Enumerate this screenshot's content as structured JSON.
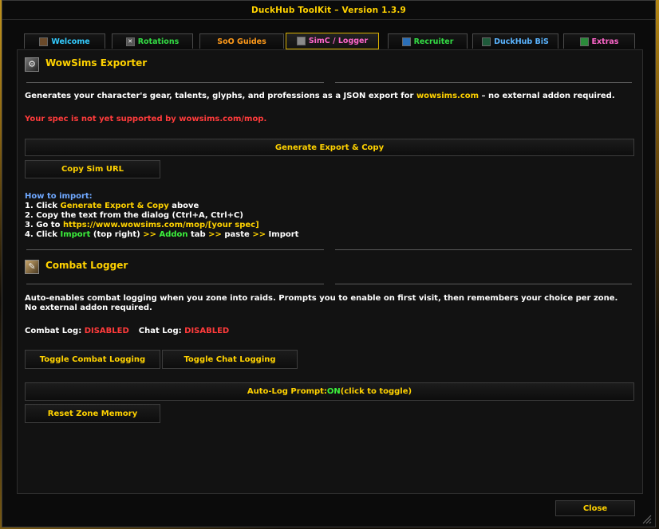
{
  "window": {
    "title": "DuckHub ToolKit  –  Version 1.3.9",
    "close_label": "Close"
  },
  "tabs": [
    {
      "label": "Welcome",
      "icon": "welcome-icon",
      "color": "#33ccff"
    },
    {
      "label": "Rotations",
      "icon": "rotations-icon",
      "color": "#33dd44"
    },
    {
      "label": "SoO Guides",
      "icon": "",
      "color": "#ff9a1a"
    },
    {
      "label": "SimC / Logger",
      "icon": "simc-icon",
      "color": "#ff66cc",
      "active": true
    },
    {
      "label": "Recruiter",
      "icon": "recruiter-icon",
      "color": "#33dd44"
    },
    {
      "label": "DuckHub BiS",
      "icon": "bis-icon",
      "color": "#5ab4ff"
    },
    {
      "label": "Extras",
      "icon": "extras-icon",
      "color": "#ff66cc"
    }
  ],
  "exporter": {
    "title": "WowSims Exporter",
    "desc_prefix": "Generates your character's gear, talents, glyphs, and professions as a JSON export for ",
    "desc_link": "wowsims.com",
    "desc_suffix": " –  no external addon required.",
    "warning": "Your spec is not yet supported by wowsims.com/mop.",
    "generate_label": "Generate Export & Copy",
    "copy_url_label": "Copy Sim URL",
    "howto_heading": "How to import:",
    "step1_prefix": "1. Click ",
    "step1_hl": "Generate Export & Copy",
    "step1_suffix": " above",
    "step2": "2. Copy the text from the dialog (Ctrl+A, Ctrl+C)",
    "step3_prefix": "3. Go to ",
    "step3_hl": "https://www.wowsims.com/mop/[your spec]",
    "step4_prefix": "4. Click ",
    "step4_import": "Import",
    "step4_mid": " (top right) ",
    "step4_arrow1": ">>",
    "step4_addon": " Addon",
    "step4_tab": " tab ",
    "step4_arrow2": ">>",
    "step4_paste": " paste ",
    "step4_arrow3": ">>",
    "step4_end": " Import"
  },
  "logger": {
    "title": "Combat Logger",
    "desc": "Auto-enables combat logging when you zone into raids. Prompts you to enable on first visit, then remembers your choice per zone. No external addon required.",
    "combat_label": "Combat Log:",
    "combat_value": "DISABLED",
    "chat_label": "Chat Log:",
    "chat_value": "DISABLED",
    "toggle_combat_label": "Toggle Combat Logging",
    "toggle_chat_label": "Toggle Chat Logging",
    "autolog_prefix": "Auto-Log Prompt: ",
    "autolog_value": "ON",
    "autolog_suffix": "  (click to toggle)",
    "reset_label": "Reset Zone Memory"
  }
}
